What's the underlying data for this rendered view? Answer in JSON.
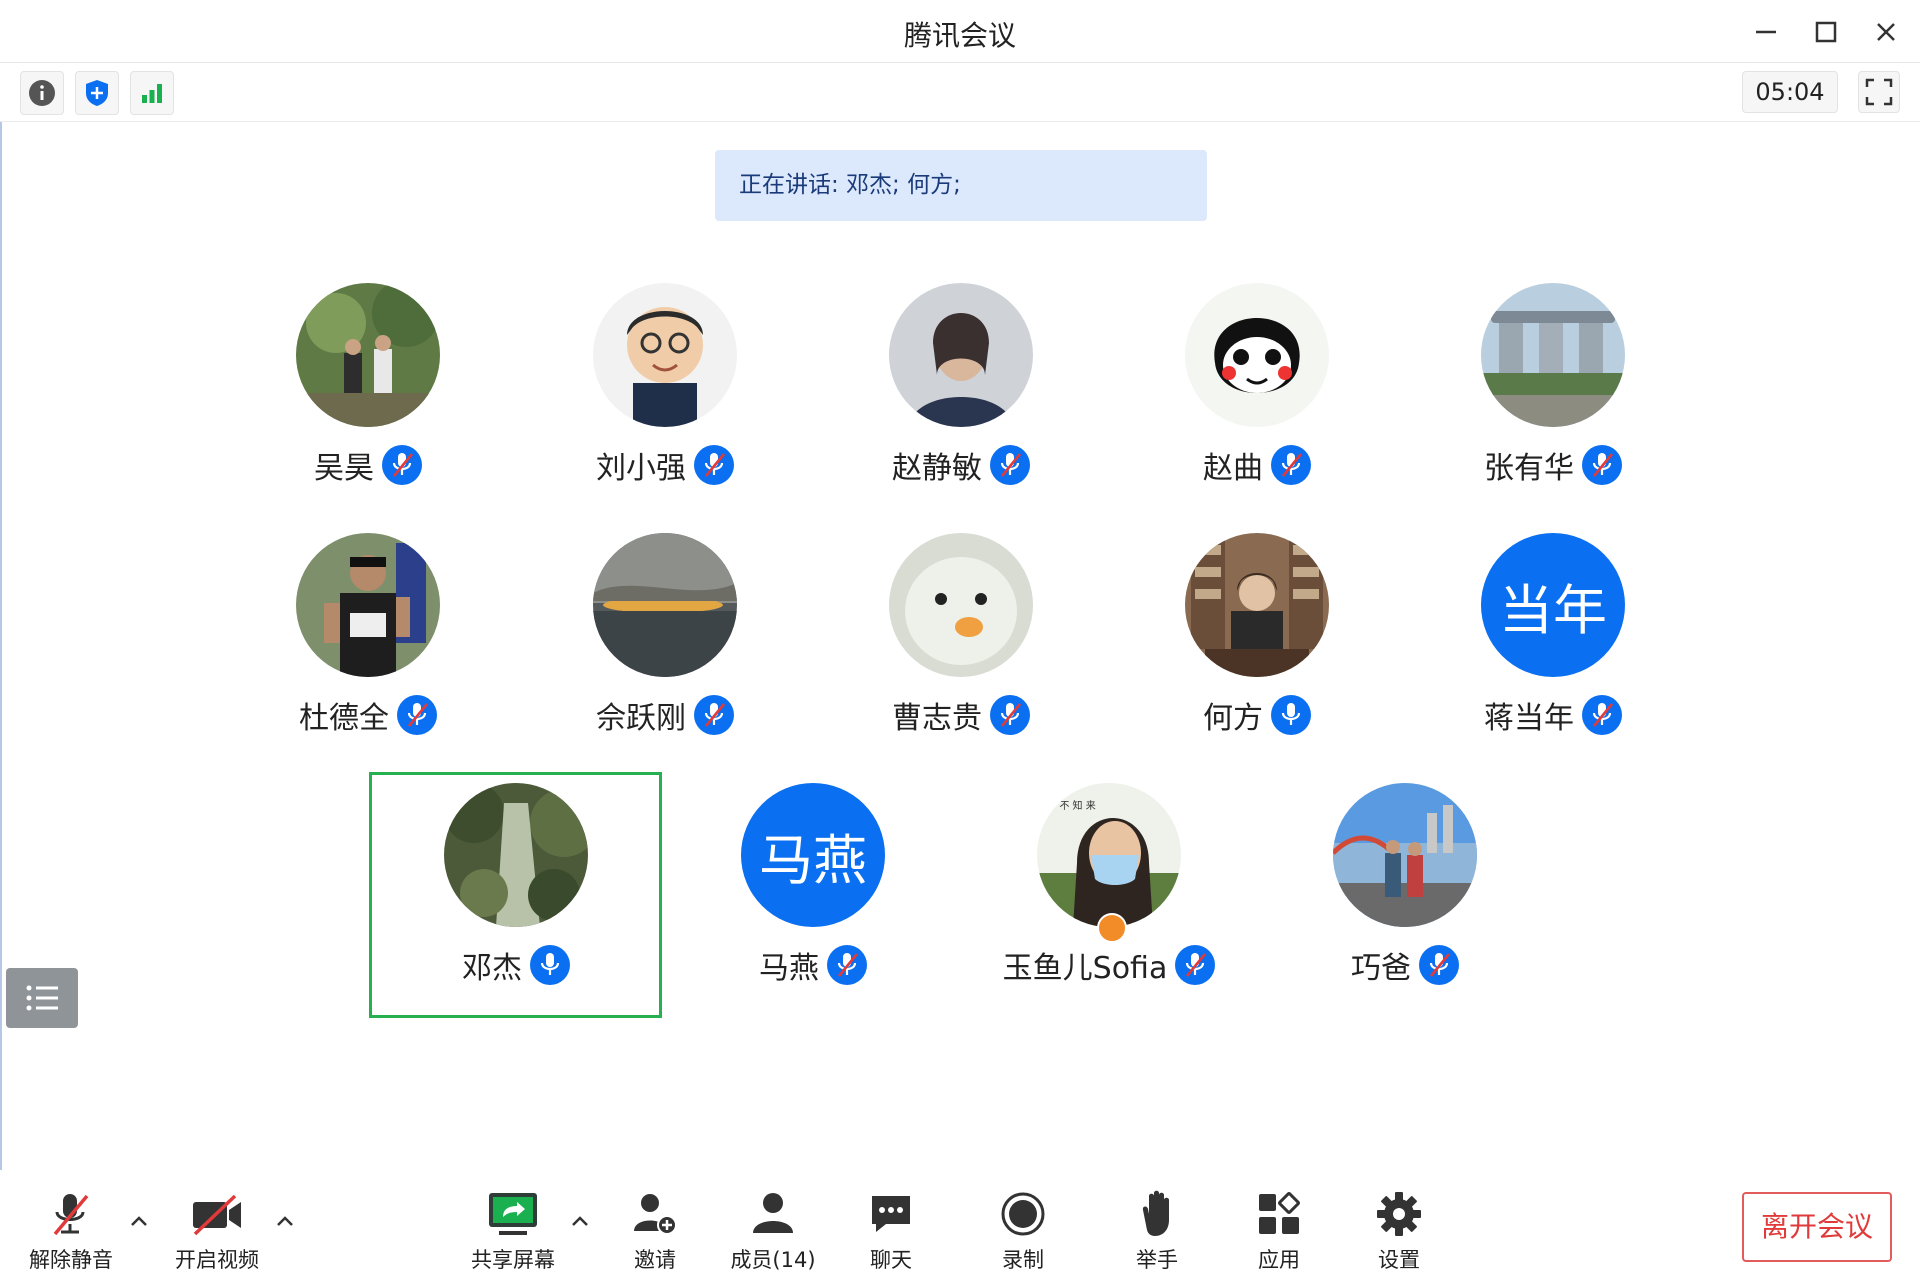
{
  "window": {
    "title": "腾讯会议"
  },
  "toolbar": {
    "timer": "05:04"
  },
  "speaking": {
    "text": "正在讲话: 邓杰; 何方;"
  },
  "participants": [
    {
      "name": "吴昊",
      "mic": "muted",
      "avatar": "photo-forest"
    },
    {
      "name": "刘小强",
      "mic": "muted",
      "avatar": "photo-cartoon-man"
    },
    {
      "name": "赵静敏",
      "mic": "muted",
      "avatar": "photo-portrait"
    },
    {
      "name": "赵曲",
      "mic": "muted",
      "avatar": "photo-cartoon-face"
    },
    {
      "name": "张有华",
      "mic": "muted",
      "avatar": "photo-building"
    },
    {
      "name": "杜德全",
      "mic": "muted",
      "avatar": "photo-runner"
    },
    {
      "name": "佘跃刚",
      "mic": "muted",
      "avatar": "photo-sunset"
    },
    {
      "name": "曹志贵",
      "mic": "muted",
      "avatar": "photo-plush"
    },
    {
      "name": "何方",
      "mic": "on",
      "avatar": "photo-office"
    },
    {
      "name": "蒋当年",
      "mic": "muted",
      "avatar": "text",
      "avatar_text": "当年"
    },
    {
      "name": "邓杰",
      "mic": "on",
      "avatar": "photo-waterfall"
    },
    {
      "name": "马燕",
      "mic": "muted",
      "avatar": "text",
      "avatar_text": "马燕"
    },
    {
      "name": "玉鱼儿Sofia",
      "mic": "muted",
      "avatar": "photo-mask-girl"
    },
    {
      "name": "巧爸",
      "mic": "muted",
      "avatar": "photo-bridge"
    }
  ],
  "bottombar": {
    "unmute": "解除静音",
    "video": "开启视频",
    "share": "共享屏幕",
    "invite": "邀请",
    "members": "成员(14)",
    "chat": "聊天",
    "record": "录制",
    "raise_hand": "举手",
    "apps": "应用",
    "settings": "设置",
    "leave": "离开会议"
  },
  "colors": {
    "accent": "#0a6ff0",
    "speaker_highlight": "#27b04f",
    "leave": "#e03a3a"
  }
}
